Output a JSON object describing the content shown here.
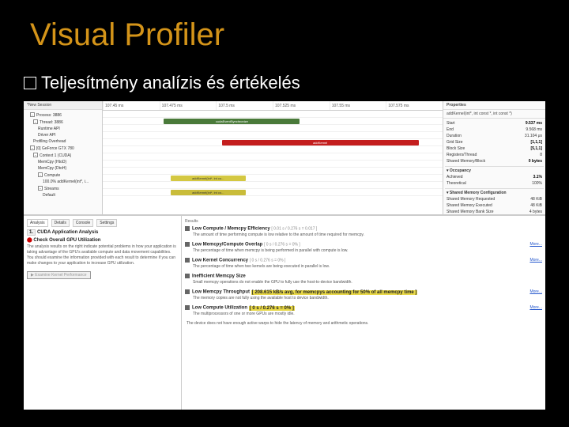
{
  "title": "Visual Profiler",
  "subtitle": "Teljesítmény analízis és értékelés",
  "timeline_header": "*New Session",
  "time_ticks": [
    "107.45 ms",
    "107.475 ms",
    "107.5 ms",
    "107.525 ms",
    "107.55 ms",
    "107.575 ms"
  ],
  "tree": {
    "process": "Process: 3886",
    "thread": "Thread: 3886",
    "runtime": "Runtime API",
    "driver": "Driver API",
    "profiling": "Profiling Overhead",
    "gpu": "[0] GeForce GTX 780",
    "context": "Context 1 (CUDA)",
    "memcpy_htod": "MemCpy (HtoD)",
    "memcpy_dtoh": "MemCpy (DtoH)",
    "compute": "Compute",
    "kernel_a": "100.0% addKernel(int*, i...",
    "streams": "Streams",
    "default": "Default"
  },
  "bars": {
    "green": "cudaEventSynchronize",
    "red": "addKernel",
    "y1": "addKernel(int*, int co...",
    "y2": "addKernel(int*, int co..."
  },
  "props": {
    "header": "Properties",
    "subhdr": "addKernel(int*, int const *, int const *)",
    "rows": [
      {
        "k": "Start",
        "v": "9.537 ms"
      },
      {
        "k": "End",
        "v": "9.568 ms"
      },
      {
        "k": "Duration",
        "v": "31.104 μs"
      },
      {
        "k": "Grid Size",
        "v": "[1,1,1]"
      },
      {
        "k": "Block Size",
        "v": "[5,1,1]"
      },
      {
        "k": "Registers/Thread",
        "v": "8"
      },
      {
        "k": "Shared Memory/Block",
        "v": "0 bytes"
      }
    ],
    "occupancy_hdr": "Occupancy",
    "occupancy": [
      {
        "k": "Achieved",
        "v": "3.1%"
      },
      {
        "k": "Theoretical",
        "v": "100%"
      }
    ],
    "shared_hdr": "Shared Memory Configuration",
    "shared": [
      {
        "k": "Shared Memory Requested",
        "v": "48 KiB"
      },
      {
        "k": "Shared Memory Executed",
        "v": "48 KiB"
      },
      {
        "k": "Shared Memory Bank Size",
        "v": "4 bytes"
      }
    ]
  },
  "analysis": {
    "tabs": [
      "Analysis",
      "Details",
      "Console",
      "Settings"
    ],
    "s1_title": "CUDA Application Analysis",
    "s1_num": "1.",
    "s2_title": "Check Overall GPU Utilization",
    "s2_body": "The analysis results on the right indicate potential problems in how your application is taking advantage of the GPU's available compute and data movement capabilities. You should examine the information provided with each result to determine if you can make changes to your application to increase GPU utilization.",
    "btn": "Examine Kernel Performance",
    "results_label": "Results",
    "r1_t": "Low Compute / Memcpy Efficiency",
    "r1_g": "[ 0.01 s / 0.276 s = 0.017 ]",
    "r1_d": "The amount of time performing compute is low relative to the amount of time required for memcpy.",
    "r2_t": "Low Memcpy/Compute Overlap",
    "r2_g": "[ 0 s / 0.276 s = 0% ]",
    "r2_d": "The percentage of time when memcpy is being performed in parallel with compute is low.",
    "r3_t": "Low Kernel Concurrency",
    "r3_g": "[ 0 s / 0.276 s = 0% ]",
    "r3_d": "The percentage of time when two kernels are being executed in parallel is low.",
    "r4_t": "Inefficient Memcpy Size",
    "r4_d": "Small memcpy operations do not enable the GPU to fully use the host-to-device bandwidth.",
    "r5_t": "Low Memcpy Throughput",
    "r5_g": "[ 208.615 kB/s avg, for memcpys accounting for 50% of all memcpy time ]",
    "r5_d": "The memory copies are not fully using the available host to device bandwidth.",
    "r6_t": "Low Compute Utilization",
    "r6_g": "[ 0 s / 0.276 s = 0% ]",
    "r6_d": "The multiprocessors of one or more GPUs are mostly idle.",
    "r7_d": "The device does not have enough active warps to hide the latency of memory and arithmetic operations.",
    "more": "More..."
  }
}
